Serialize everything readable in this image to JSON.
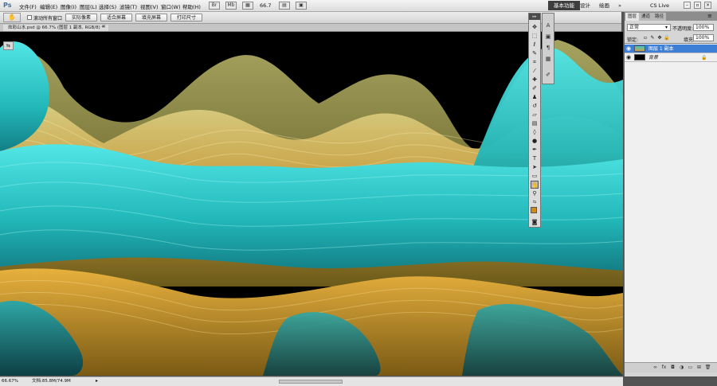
{
  "app": {
    "logo": "Ps",
    "menus": [
      "文件(F)",
      "编辑(E)",
      "图像(I)",
      "图层(L)",
      "选择(S)",
      "滤镜(T)",
      "视图(V)",
      "窗口(W)",
      "帮助(H)"
    ],
    "zoom_readout": "66.7",
    "workspaces": {
      "active": "基本功能",
      "design": "设计",
      "paint": "绘画",
      "more": "»"
    },
    "cs_live": "CS Live"
  },
  "options": {
    "scroll_all_label": "滚动所有窗口",
    "buttons": [
      "实际像素",
      "适合屏幕",
      "填充屏幕",
      "打印尺寸"
    ]
  },
  "document": {
    "tab_title": "炫彩山水.psd @ 66.7% (图层 1 副本, RGB/8) *",
    "close": "×"
  },
  "status": {
    "zoom": "66.67%",
    "doc_size": "文档:85.8M/74.9M"
  },
  "layers_panel": {
    "tabs": [
      "图层",
      "通道",
      "路径"
    ],
    "blend_mode": "正常",
    "opacity_label": "不透明度:",
    "opacity": "100%",
    "lock_label": "锁定:",
    "fill_label": "填充:",
    "fill": "100%",
    "layers": [
      {
        "name": "图层 1 副本",
        "selected": true
      },
      {
        "name": "背景",
        "selected": false
      }
    ]
  }
}
